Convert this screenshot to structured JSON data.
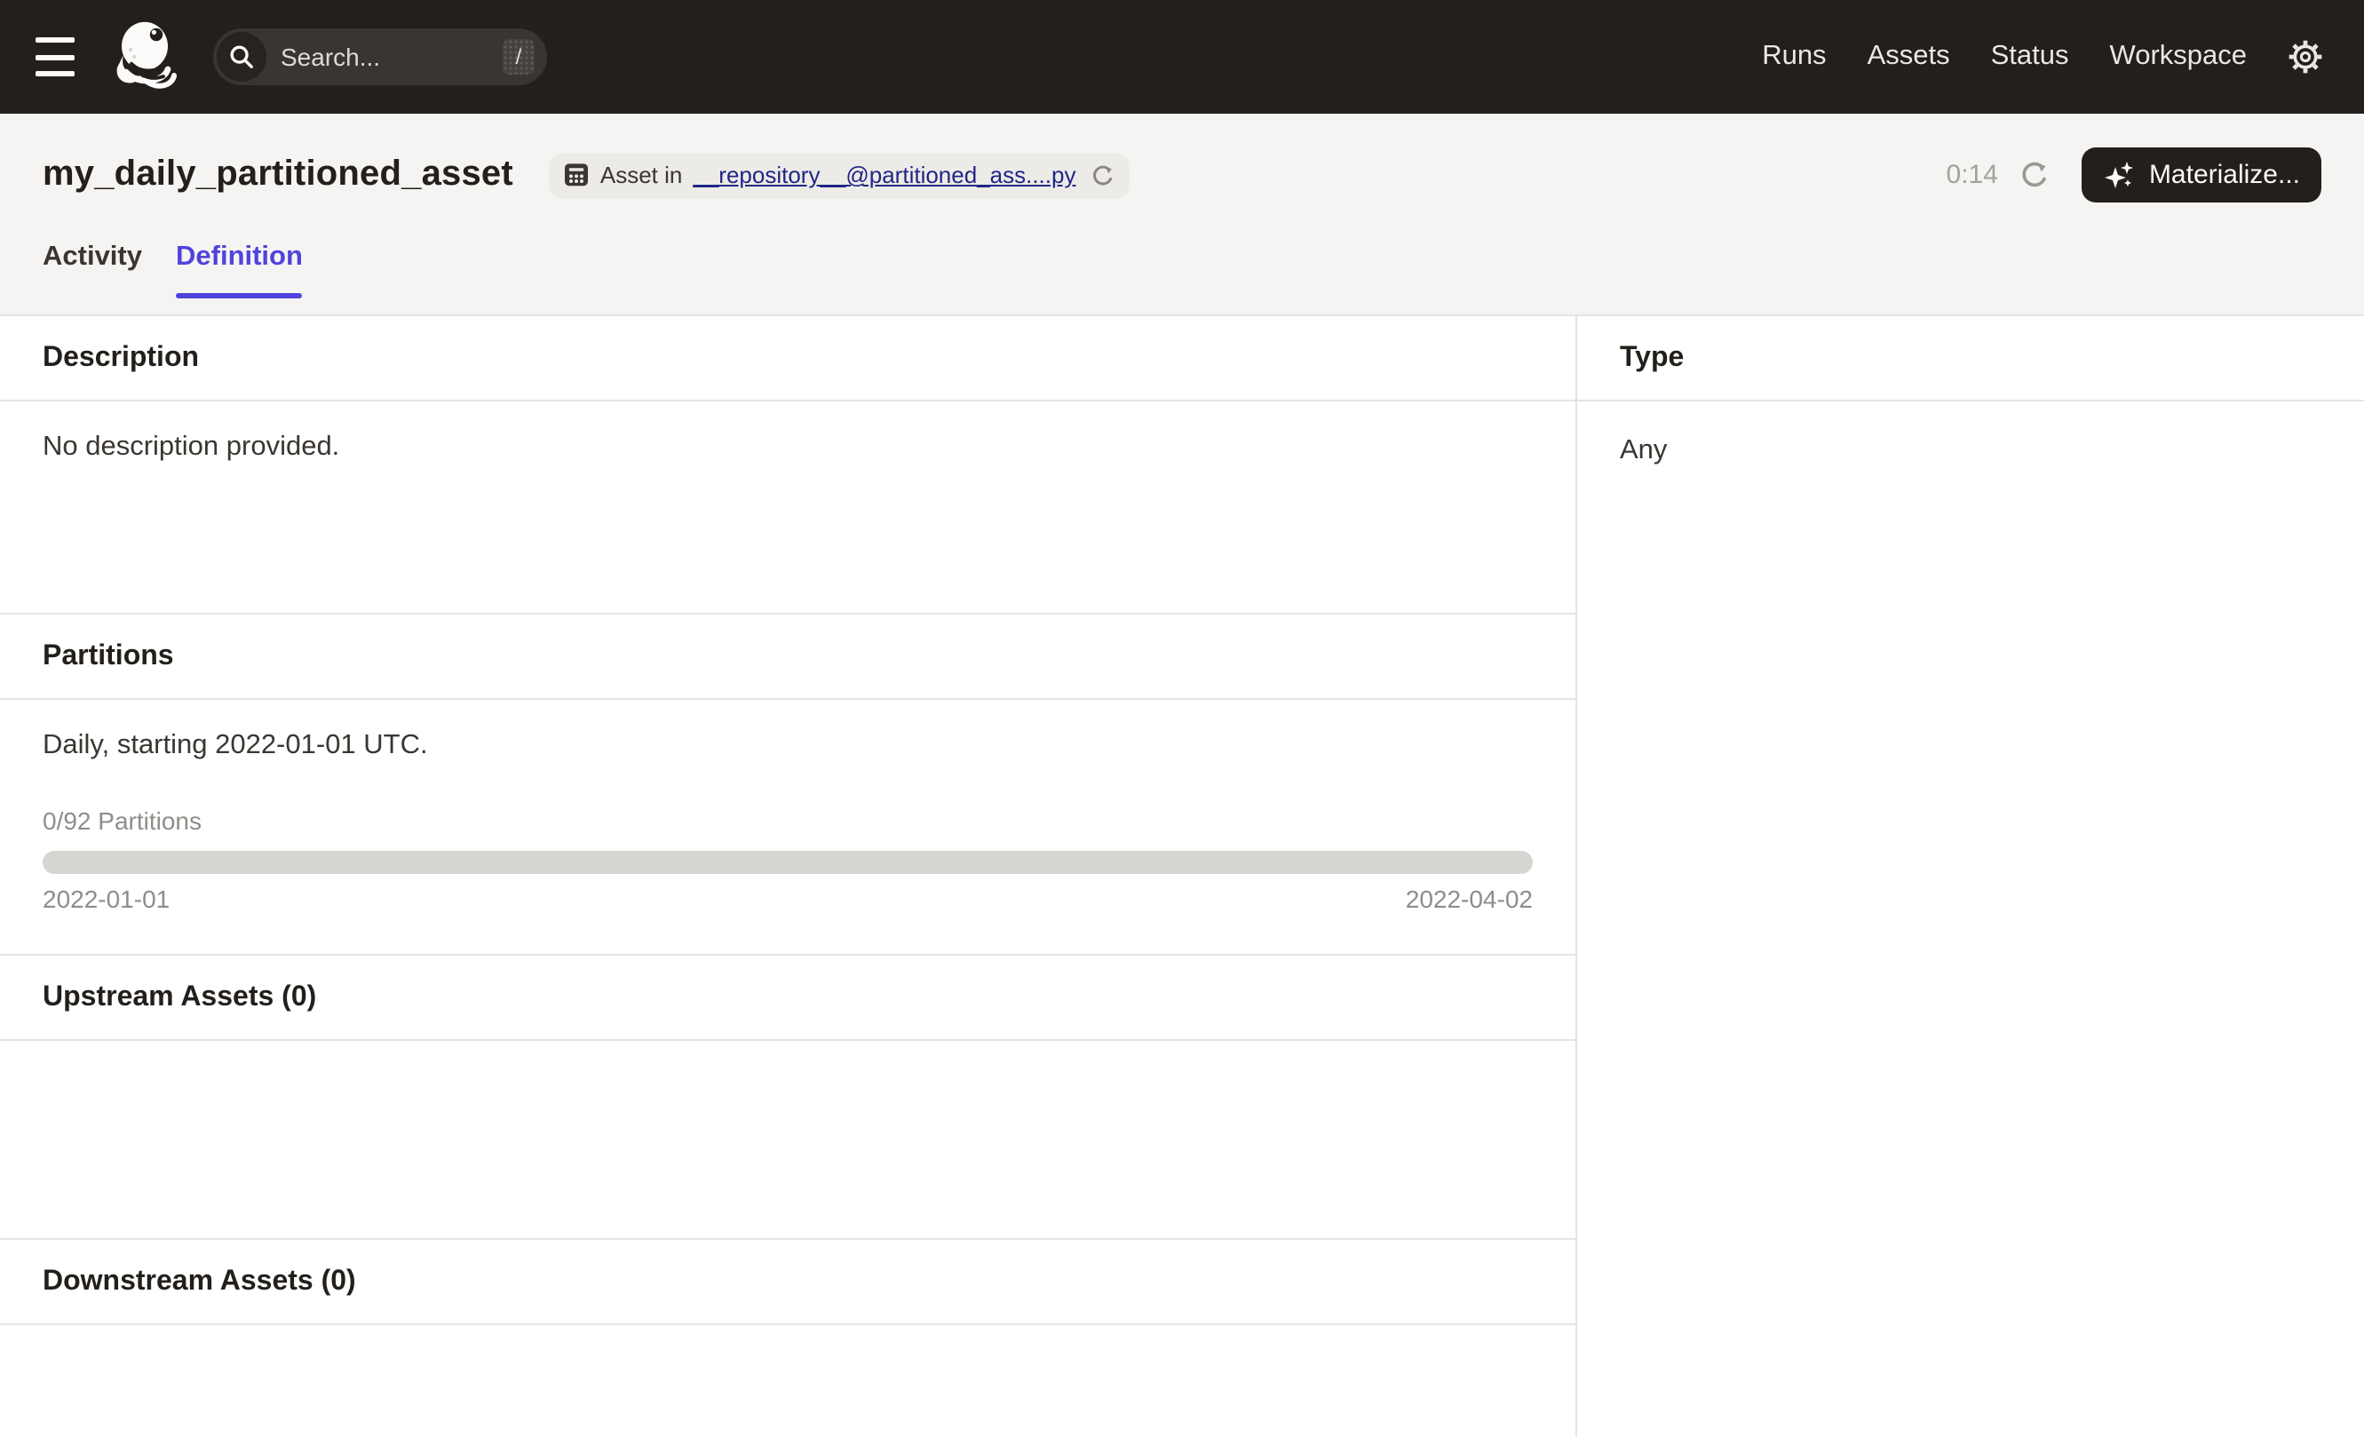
{
  "nav": {
    "search_placeholder": "Search...",
    "shortcut_key": "/",
    "links": [
      "Runs",
      "Assets",
      "Status",
      "Workspace"
    ]
  },
  "header": {
    "title": "my_daily_partitioned_asset",
    "asset_tag_prefix": "Asset in",
    "asset_tag_link": "__repository__@partitioned_ass....py",
    "refresh_countdown": "0:14",
    "materialize_label": "Materialize..."
  },
  "tabs": [
    {
      "label": "Activity",
      "active": false
    },
    {
      "label": "Definition",
      "active": true
    }
  ],
  "sections": {
    "description": {
      "heading": "Description",
      "body": "No description provided."
    },
    "type": {
      "heading": "Type",
      "value": "Any"
    },
    "partitions": {
      "heading": "Partitions",
      "summary": "Daily, starting 2022-01-01 UTC.",
      "progress_label": "0/92 Partitions",
      "partitions_materialized": 0,
      "partitions_total": 92,
      "range_start": "2022-01-01",
      "range_end": "2022-04-02"
    },
    "upstream": {
      "heading": "Upstream Assets (0)"
    },
    "downstream": {
      "heading": "Downstream Assets (0)"
    }
  },
  "colors": {
    "navbar_bg": "#221F1C",
    "header_bg": "#F5F4F2",
    "accent_tab": "#4F43DD",
    "link_navy": "#1F2787",
    "divider": "#E6E4E1",
    "text_primary": "#231F1B",
    "text_muted": "#8F8D88",
    "progress_track": "#D8D6D3",
    "button_bg": "#231F1B",
    "chip_bg": "#EDEBE7"
  }
}
